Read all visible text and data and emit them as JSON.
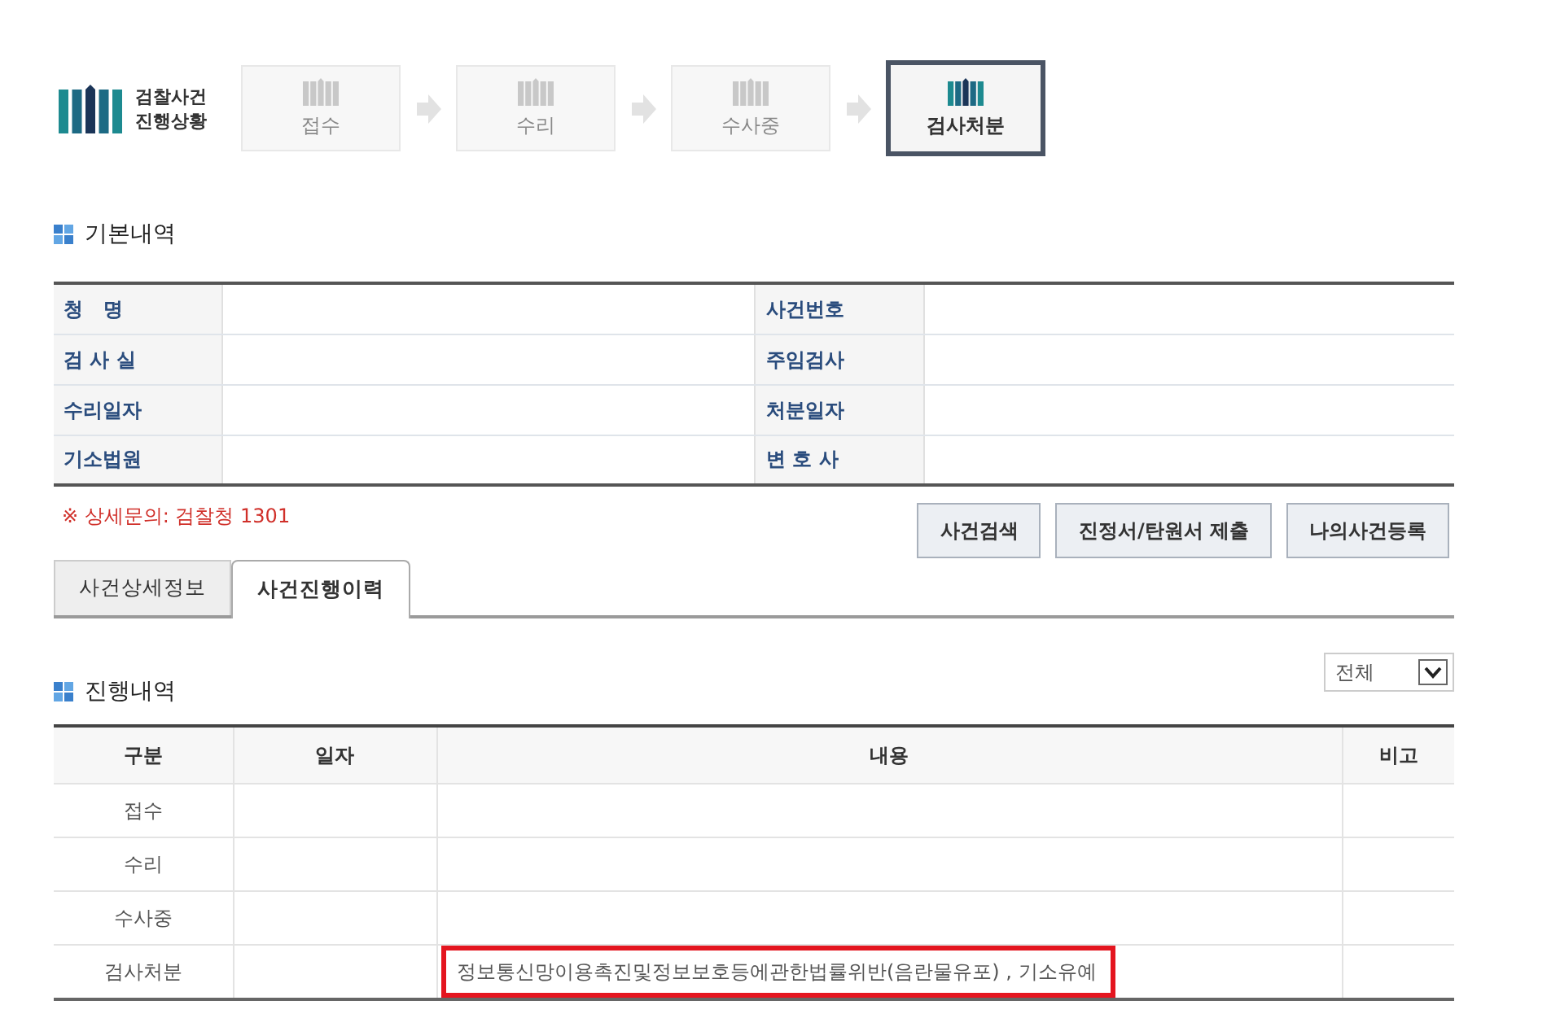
{
  "logo": {
    "lines": [
      "검찰사건",
      "진행상황"
    ]
  },
  "steps": [
    {
      "label": "접수",
      "selected": false
    },
    {
      "label": "수리",
      "selected": false
    },
    {
      "label": "수사중",
      "selected": false
    },
    {
      "label": "검사처분",
      "selected": true
    }
  ],
  "basic_info": {
    "title": "기본내역",
    "fields": [
      {
        "label": "청   명"
      },
      {
        "label": "사건번호"
      },
      {
        "label": "검 사 실"
      },
      {
        "label": "주임검사"
      },
      {
        "label": "수리일자"
      },
      {
        "label": "처분일자"
      },
      {
        "label": "기소법원"
      },
      {
        "label": "변 호 사"
      }
    ]
  },
  "notice": "※ 상세문의: 검찰청 1301",
  "buttons": [
    "사건검색",
    "진정서/탄원서 제출",
    "나의사건등록"
  ],
  "tabs": [
    {
      "label": "사건상세정보",
      "selected": false
    },
    {
      "label": "사건진행이력",
      "selected": true
    }
  ],
  "progress": {
    "title": "진행내역",
    "filter": {
      "value": "전체"
    },
    "columns": [
      "구분",
      "일자",
      "내용",
      "비고"
    ],
    "rows": [
      {
        "stage": "접수",
        "highlighted": false
      },
      {
        "stage": "수리",
        "highlighted": false
      },
      {
        "stage": "수사중",
        "highlighted": false
      },
      {
        "stage": "검사처분",
        "content": "정보통신망이용촉진및정보보호등에관한법률위반(음란물유포) , 기소유예",
        "highlighted": true
      }
    ]
  }
}
